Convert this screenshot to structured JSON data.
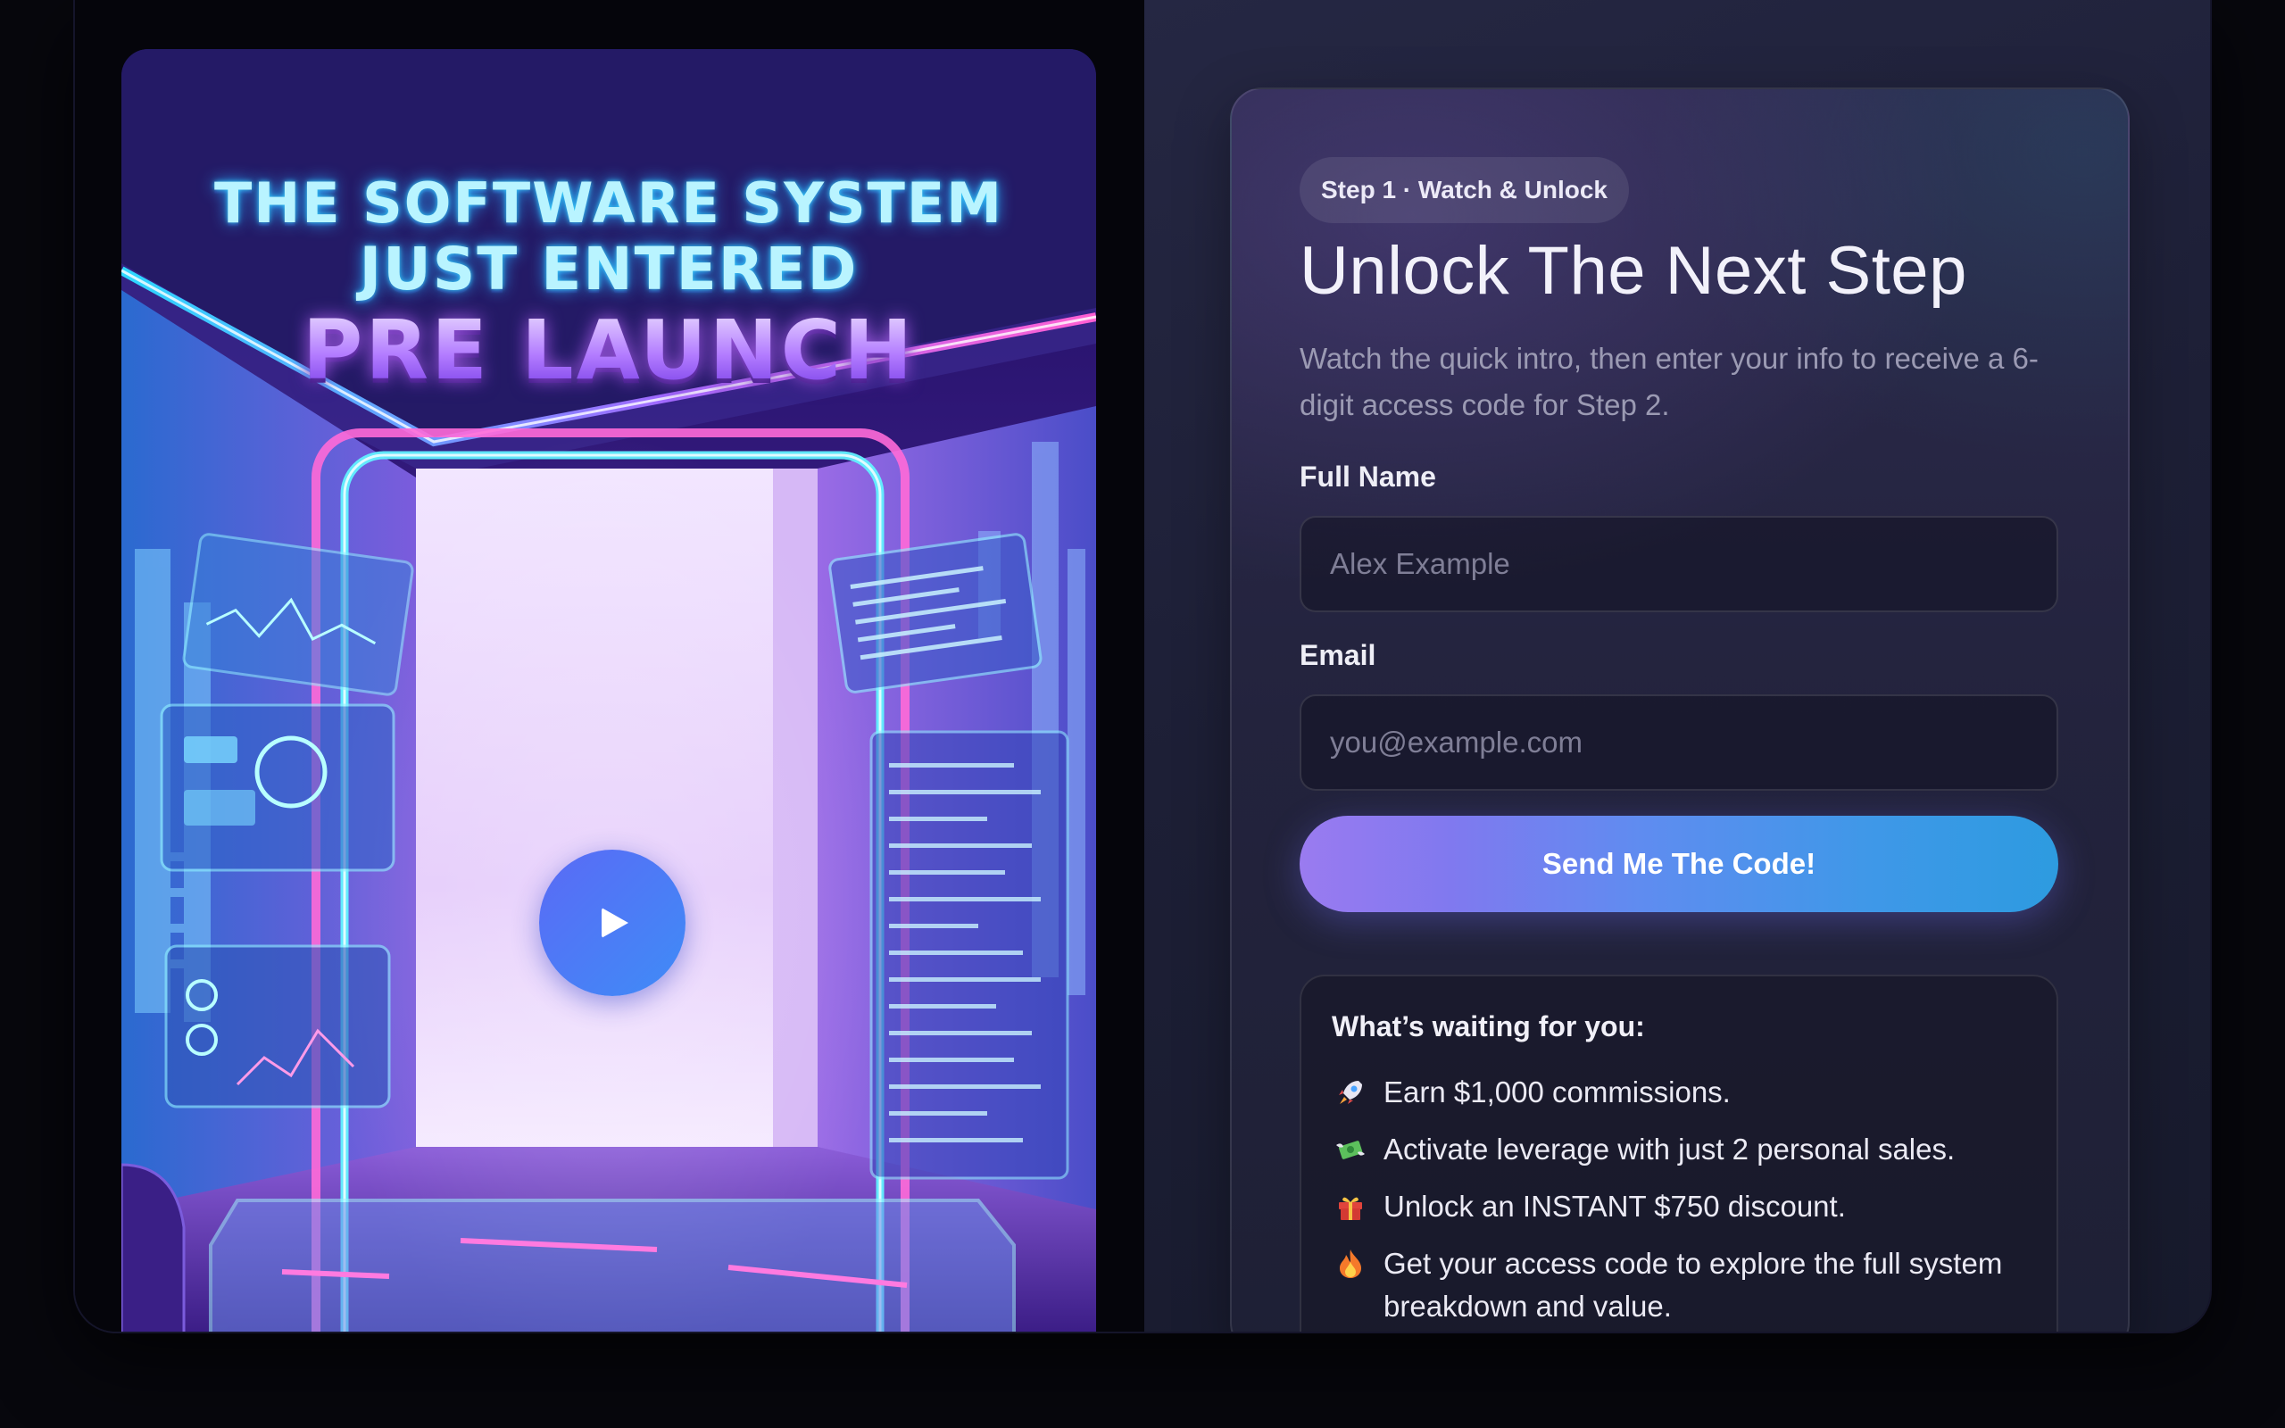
{
  "poster": {
    "headline_line1": "THE SOFTWARE SYSTEM",
    "headline_line2": "JUST ENTERED",
    "headline_line3": "PRE LAUNCH"
  },
  "form": {
    "step_badge": "Step 1 · Watch & Unlock",
    "title": "Unlock The Next Step",
    "subtitle": "Watch the quick intro, then enter your info to receive a 6-digit access code for Step 2.",
    "name_label": "Full Name",
    "name_placeholder": "Alex Example",
    "email_label": "Email",
    "email_placeholder": "you@example.com",
    "submit_label": "Send Me The Code!"
  },
  "benefits": {
    "title": "What’s waiting for you:",
    "items": [
      {
        "icon": "rocket-icon",
        "text": "Earn $1,000 commissions."
      },
      {
        "icon": "money-wings-icon",
        "text": "Activate leverage with just 2 personal sales."
      },
      {
        "icon": "gift-icon",
        "text": "Unlock an INSTANT $750 discount."
      },
      {
        "icon": "fire-icon",
        "text": "Get your access code to explore the full system breakdown and value."
      }
    ]
  },
  "colors": {
    "accent_start": "#9a7bf0",
    "accent_end": "#2d9be0",
    "play_button": "#4f7bf6",
    "panel_bg": "#1d1f36"
  }
}
